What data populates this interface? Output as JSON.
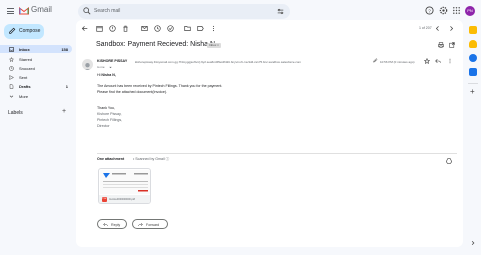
{
  "app": {
    "name": "Gmail"
  },
  "search": {
    "placeholder": "Search mail"
  },
  "user": {
    "initials": "PN"
  },
  "compose": {
    "label": "Compose"
  },
  "sidebar": {
    "items": [
      {
        "label": "Inbox",
        "count": "158",
        "icon": "inbox-icon"
      },
      {
        "label": "Starred",
        "count": "",
        "icon": "star-icon"
      },
      {
        "label": "Snoozed",
        "count": "",
        "icon": "clock-icon"
      },
      {
        "label": "Sent",
        "count": "",
        "icon": "send-icon"
      },
      {
        "label": "Drafts",
        "count": "1",
        "icon": "file-icon"
      },
      {
        "label": "More",
        "count": "",
        "icon": "chevron-down-icon"
      }
    ],
    "labels_title": "Labels"
  },
  "toolbar": {
    "pager": "1 of 207"
  },
  "email": {
    "subject": "Sandbox: Payment Recieved: Nisha N",
    "badge": "Inbox ×",
    "sender_name": "KISHORE PISSAY",
    "sender_email": "kishorepissay.fntsysmail.com.gg.7f4myggjsoftvrzj.9y2.sea6m0f9et4f42tt.bnyvtn.rb-1a.9d4.cs175.bnc.sandbox.salesforce.com",
    "to": "to me",
    "date": "10:56 PM (0 minutes ago)",
    "greeting_prefix": "Hi",
    "greeting_name": "Nisha N,",
    "body_lines": [
      "The Amount has been received by Pintech Fillings. Thank you for the payment.",
      "Please find the attached document(Invoice)."
    ],
    "signature": [
      "Thank You,",
      "Kishore Pissay,",
      "Pintech Fillings,",
      "Director"
    ]
  },
  "attachments": {
    "title": "One attachment",
    "scanned": "• Scanned by Gmail ⓘ",
    "file_name": "Invoice0000000000.pdf",
    "file_type": "PDF"
  },
  "actions": {
    "reply": "Reply",
    "forward": "Forward"
  }
}
